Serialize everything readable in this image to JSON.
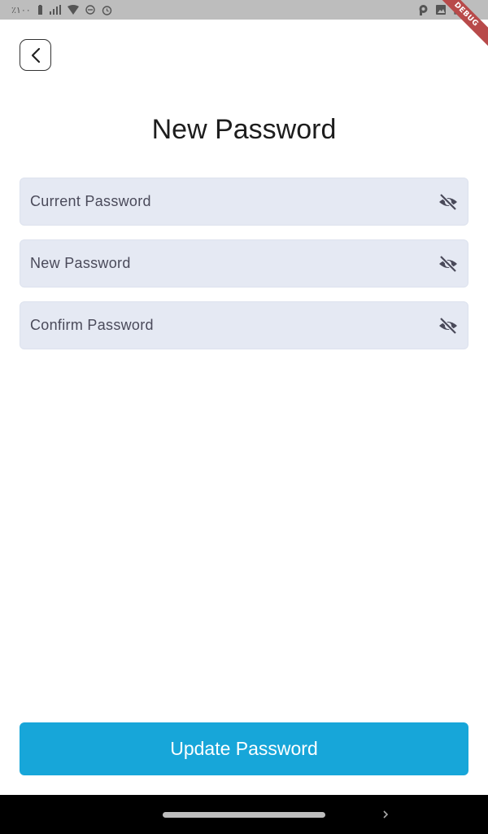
{
  "status_bar": {
    "battery_text": "٪١٠٠",
    "debug_label": "DEBUG"
  },
  "header": {
    "title": "New Password"
  },
  "form": {
    "current_password_placeholder": "Current Password",
    "new_password_placeholder": "New Password",
    "confirm_password_placeholder": "Confirm Password",
    "visibility_icon": "eye-off-icon"
  },
  "actions": {
    "update_label": "Update Password"
  },
  "colors": {
    "primary": "#17a6d9",
    "field_bg": "#e5e9f3",
    "status_bar": "#bdbdbd"
  }
}
